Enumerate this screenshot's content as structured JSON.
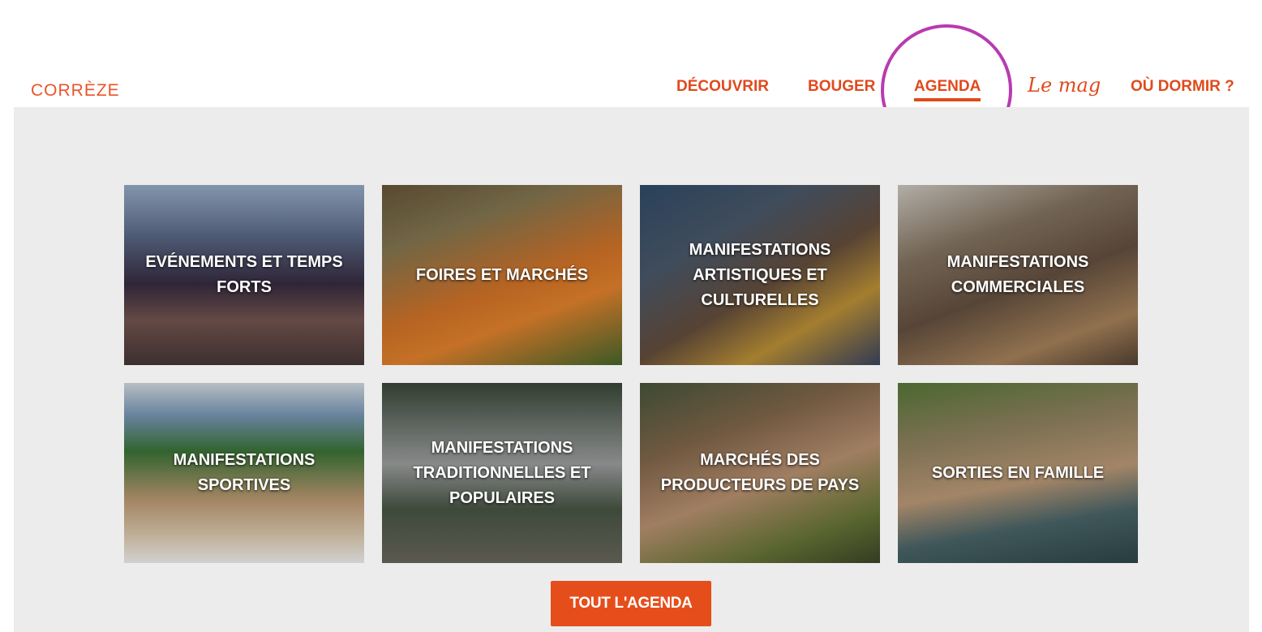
{
  "header": {
    "logo": "CORRÈZE",
    "nav": [
      {
        "label": "DÉCOUVRIR"
      },
      {
        "label": "BOUGER"
      },
      {
        "label": "AGENDA",
        "active": true
      },
      {
        "label": "Le mag"
      },
      {
        "label": "OÙ DORMIR ?"
      }
    ]
  },
  "categories": [
    {
      "label": "EVÉNEMENTS ET TEMPS FORTS"
    },
    {
      "label": "FOIRES ET MARCHÉS"
    },
    {
      "label": "MANIFESTATIONS ARTISTIQUES ET CULTURELLES"
    },
    {
      "label": "MANIFESTATIONS COMMERCIALES"
    },
    {
      "label": "MANIFESTATIONS SPORTIVES"
    },
    {
      "label": "MANIFESTATIONS TRADITIONNELLES ET POPULAIRES"
    },
    {
      "label": "MARCHÉS DES PRODUCTEURS DE PAYS"
    },
    {
      "label": "SORTIES EN FAMILLE"
    }
  ],
  "cta": {
    "label": "TOUT L'AGENDA"
  },
  "colors": {
    "accent": "#e04a1c",
    "button": "#e54e1b",
    "highlight": "#b83bb0",
    "panel": "#ececec"
  }
}
